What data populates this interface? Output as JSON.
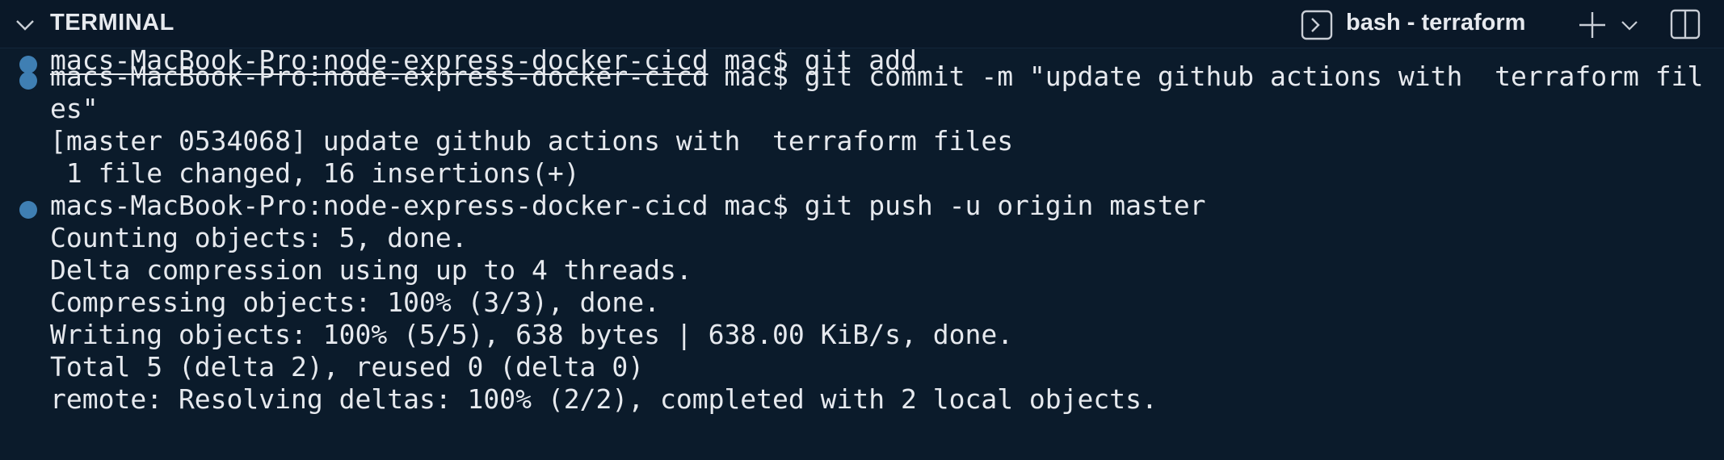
{
  "panel": {
    "title": "TERMINAL",
    "active_tab": "bash - terraform",
    "icons": {
      "collapse": "chevron-down-icon",
      "tab": "terminal-icon",
      "add": "plus-icon",
      "add_dropdown": "chevron-down-icon",
      "split": "split-editor-icon"
    },
    "colors": {
      "background": "#0b1b2b",
      "text": "#e6e9ee",
      "command_marker": "#3f7fb3"
    }
  },
  "terminal": {
    "lines": [
      {
        "text": "macs-MacBook-Pro:node-express-docker-cicd mac$ git add .",
        "marker": true
      },
      {
        "text": "macs-MacBook-Pro:node-express-docker-cicd mac$ git commit -m \"update github actions with  terraform fil",
        "marker": true
      },
      {
        "text": "es\"",
        "marker": false
      },
      {
        "text": "[master 0534068] update github actions with  terraform files",
        "marker": false
      },
      {
        "text": " 1 file changed, 16 insertions(+)",
        "marker": false
      },
      {
        "text": "macs-MacBook-Pro:node-express-docker-cicd mac$ git push -u origin master",
        "marker": true
      },
      {
        "text": "Counting objects: 5, done.",
        "marker": false
      },
      {
        "text": "Delta compression using up to 4 threads.",
        "marker": false
      },
      {
        "text": "Compressing objects: 100% (3/3), done.",
        "marker": false
      },
      {
        "text": "Writing objects: 100% (5/5), 638 bytes | 638.00 KiB/s, done.",
        "marker": false
      },
      {
        "text": "Total 5 (delta 2), reused 0 (delta 0)",
        "marker": false
      },
      {
        "text": "remote: Resolving deltas: 100% (2/2), completed with 2 local objects.",
        "marker": false
      }
    ]
  }
}
